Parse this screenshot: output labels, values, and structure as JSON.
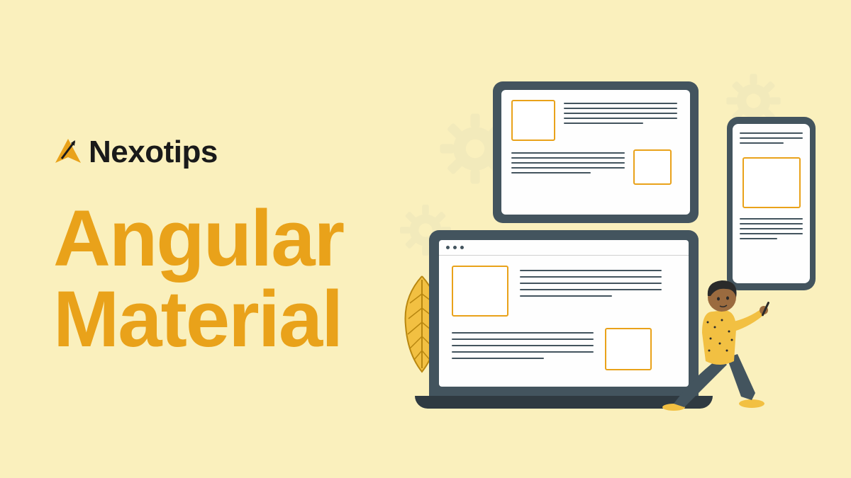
{
  "brand": {
    "name": "Nexotips"
  },
  "title": {
    "line1": "Angular",
    "line2": "Material"
  },
  "colors": {
    "background": "#faf0bd",
    "accent": "#e9a21a",
    "dark": "#43545e",
    "yellow": "#f2c042"
  }
}
